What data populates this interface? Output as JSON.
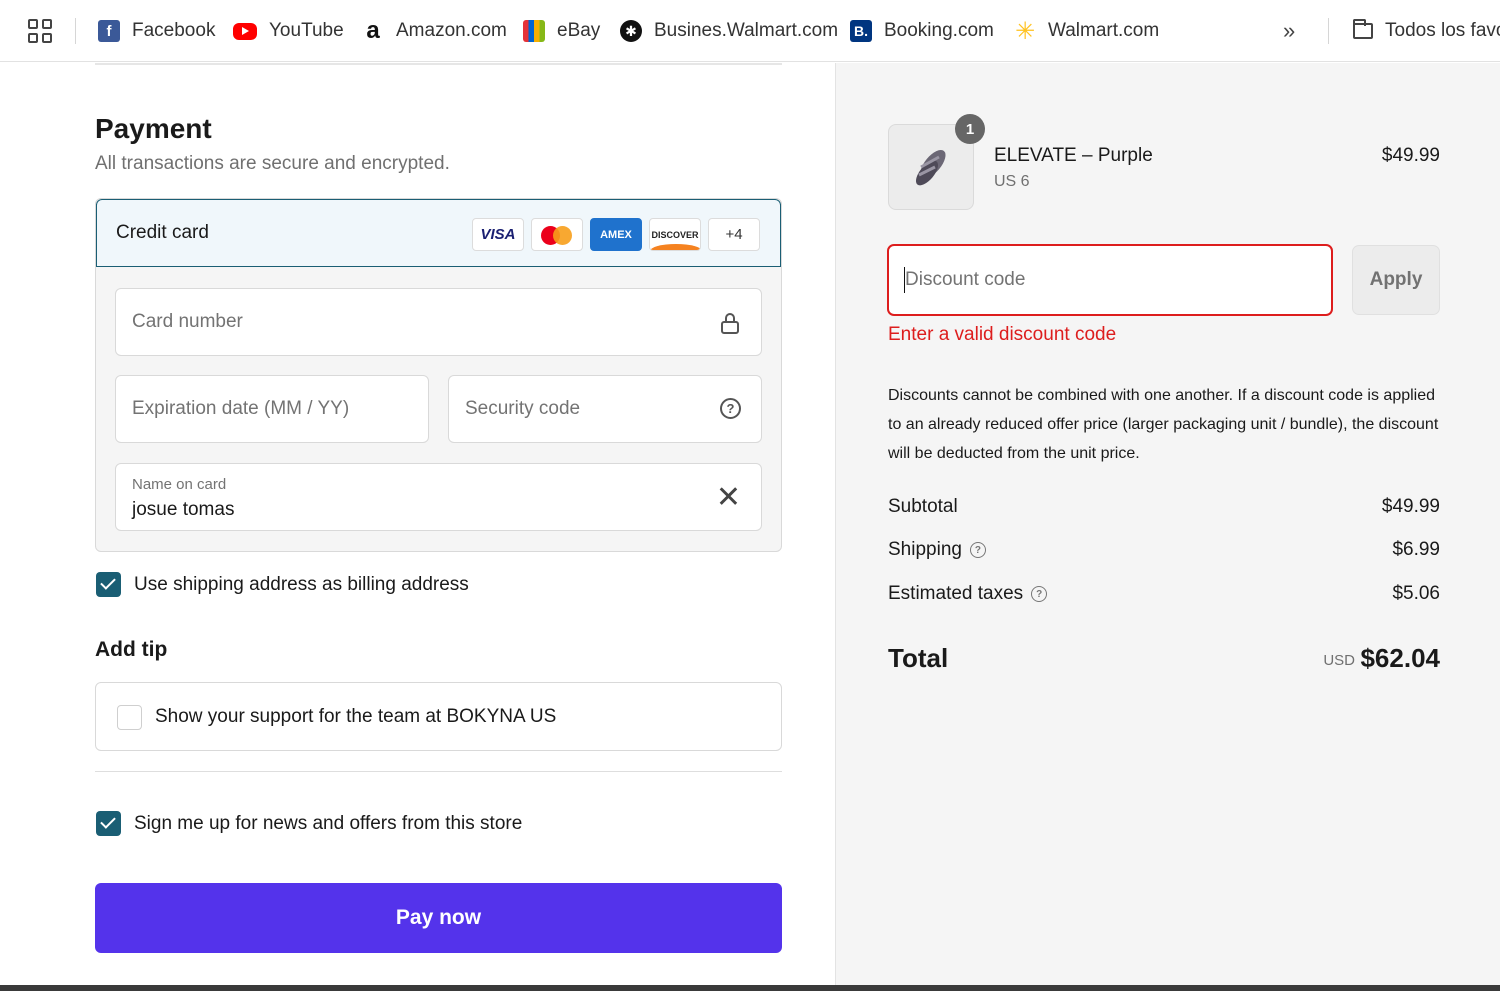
{
  "bookmarks": [
    {
      "label": "Facebook",
      "icon": "facebook-icon"
    },
    {
      "label": "YouTube",
      "icon": "youtube-icon"
    },
    {
      "label": "Amazon.com",
      "icon": "amazon-icon"
    },
    {
      "label": "eBay",
      "icon": "ebay-icon"
    },
    {
      "label": "Busines.Walmart.com",
      "icon": "walmart-business-icon"
    },
    {
      "label": "Booking.com",
      "icon": "booking-icon"
    },
    {
      "label": "Walmart.com",
      "icon": "walmart-icon"
    }
  ],
  "bookmark_glyphs": {
    "facebook": "f",
    "amazon": "a",
    "booking": "B.",
    "walmart": "✳",
    "more": "»"
  },
  "all_bookmarks_label": "Todos los favoritos",
  "payment": {
    "title": "Payment",
    "subtitle": "All transactions are secure and encrypted.",
    "method_label": "Credit card",
    "card_brands": {
      "visa": "VISA",
      "amex": "AMEX",
      "discover": "DISCOVER",
      "more": "+4"
    },
    "card_number_placeholder": "Card number",
    "expiration_placeholder": "Expiration date (MM / YY)",
    "security_placeholder": "Security code",
    "name_label": "Name on card",
    "name_value": "josue tomas",
    "billing_checkbox_label": "Use shipping address as billing address",
    "billing_checked": true
  },
  "tip": {
    "title": "Add tip",
    "checkbox_label": "Show your support for the team at BOKYNA US",
    "checked": false
  },
  "newsletter": {
    "label": "Sign me up for news and offers from this store",
    "checked": true
  },
  "pay_button": "Pay now",
  "order": {
    "item_name": "ELEVATE – Purple",
    "item_variant": "US 6",
    "item_price": "$49.99",
    "item_qty": "1"
  },
  "discount": {
    "placeholder": "Discount code",
    "apply_label": "Apply",
    "error": "Enter a valid discount code",
    "note": "Discounts cannot be combined with one another. If a discount code is applied to an already reduced offer price (larger packaging unit / bundle), the discount will be deducted from the unit price."
  },
  "summary": {
    "subtotal_label": "Subtotal",
    "subtotal": "$49.99",
    "shipping_label": "Shipping",
    "shipping": "$6.99",
    "taxes_label": "Estimated taxes",
    "taxes": "$5.06",
    "total_label": "Total",
    "currency": "USD",
    "total": "$62.04"
  },
  "colors": {
    "accent": "#5433eb",
    "checkbox": "#1a5e74",
    "error": "#dd1d1d"
  }
}
